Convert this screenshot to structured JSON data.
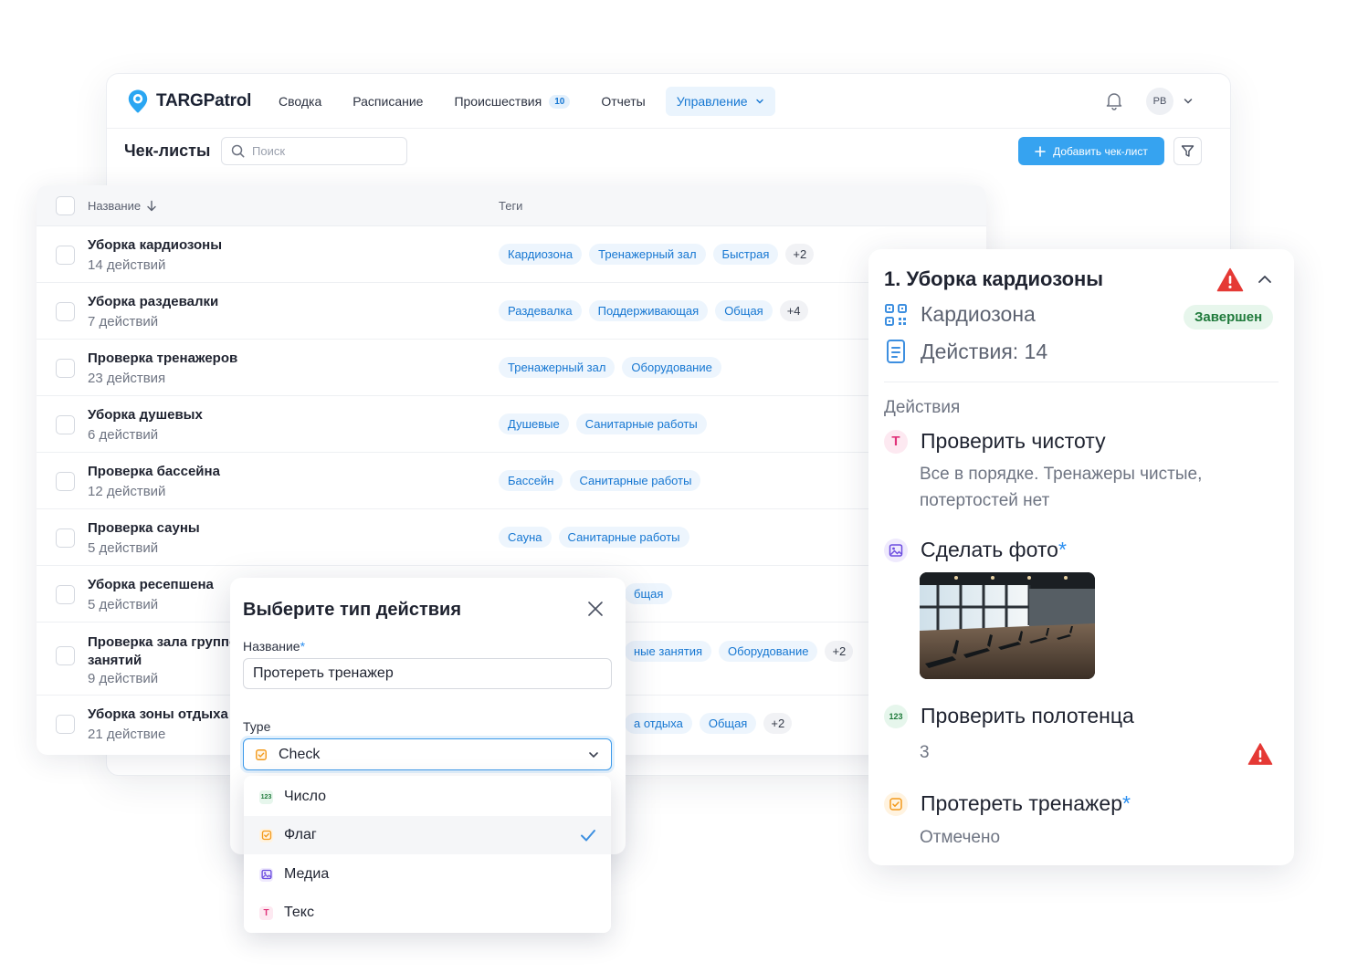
{
  "app": {
    "brand": "TARGPatrol",
    "nav": [
      {
        "label": "Сводка"
      },
      {
        "label": "Расписание"
      },
      {
        "label": "Происшествия",
        "badge": "10"
      },
      {
        "label": "Отчеты"
      },
      {
        "label": "Управление",
        "active": true
      }
    ],
    "user_initials": "PB"
  },
  "toolbar": {
    "title": "Чек-листы",
    "search_placeholder": "Поиск",
    "add_label": "Добавить чек-лист"
  },
  "table": {
    "col_name": "Название",
    "col_tags": "Теги",
    "rows": [
      {
        "title": "Уборка кардиозоны",
        "sub": "14 действий",
        "tags": [
          "Кардиозона",
          "Тренажерный зал",
          "Быстрая"
        ],
        "more": "+2"
      },
      {
        "title": "Уборка раздевалки",
        "sub": "7 действий",
        "tags": [
          "Раздевалка",
          "Поддерживающая",
          "Общая"
        ],
        "more": "+4"
      },
      {
        "title": "Проверка тренажеров",
        "sub": "23 действия",
        "tags": [
          "Тренажерный зал",
          "Оборудование"
        ]
      },
      {
        "title": "Уборка душевых",
        "sub": "6 действий",
        "tags": [
          "Душевые",
          "Санитарные работы"
        ]
      },
      {
        "title": "Проверка бассейна",
        "sub": "12 действий",
        "tags": [
          "Бассейн",
          "Санитарные работы"
        ]
      },
      {
        "title": "Проверка сауны",
        "sub": "5 действий",
        "tags": [
          "Сауна",
          "Санитарные работы"
        ]
      },
      {
        "title": "Уборка ресепшена",
        "sub": "5 действий",
        "tags": [
          "бщая"
        ]
      },
      {
        "title": "Проверка зала групповых занятий",
        "sub": "9 действий",
        "tags": [
          "ные занятия",
          "Оборудование"
        ],
        "more": "+2"
      },
      {
        "title": "Уборка зоны отдыха",
        "sub": "21 действие",
        "tags": [
          "а отдыха",
          "Общая"
        ],
        "more": "+2"
      }
    ]
  },
  "details": {
    "title": "1. Уборка кардиозоны",
    "zone": "Кардиозона",
    "status": "Завершен",
    "actions_count": "Действия: 14",
    "section": "Действия",
    "actions": [
      {
        "name": "Проверить чистоту",
        "required": "",
        "value": "Все в порядке. Тренажеры чистые, потертостей нет",
        "icon_letter": "T"
      },
      {
        "name": "Сделать фото",
        "required": "*",
        "value": "",
        "icon_letter": ""
      },
      {
        "name": "Проверить полотенца",
        "required": "",
        "value": "3",
        "icon_letter": "123"
      },
      {
        "name": "Протереть тренажер",
        "required": "*",
        "value": "Отмечено",
        "icon_letter": ""
      }
    ]
  },
  "modal": {
    "title": "Выберите тип действия",
    "name_label": "Название",
    "name_required": "*",
    "name_value": "Протереть тренажер",
    "type_label": "Type",
    "type_value": "Check",
    "options": [
      {
        "label": "Число",
        "icon_letter": "123"
      },
      {
        "label": "Флаг",
        "selected": true
      },
      {
        "label": "Медиа"
      },
      {
        "label": "Текс",
        "icon_letter": "T"
      }
    ]
  },
  "colors": {
    "accent": "#36a3f0",
    "tag_text": "#1677d2",
    "success": "#1f7a3b",
    "warning": "#e53935"
  }
}
